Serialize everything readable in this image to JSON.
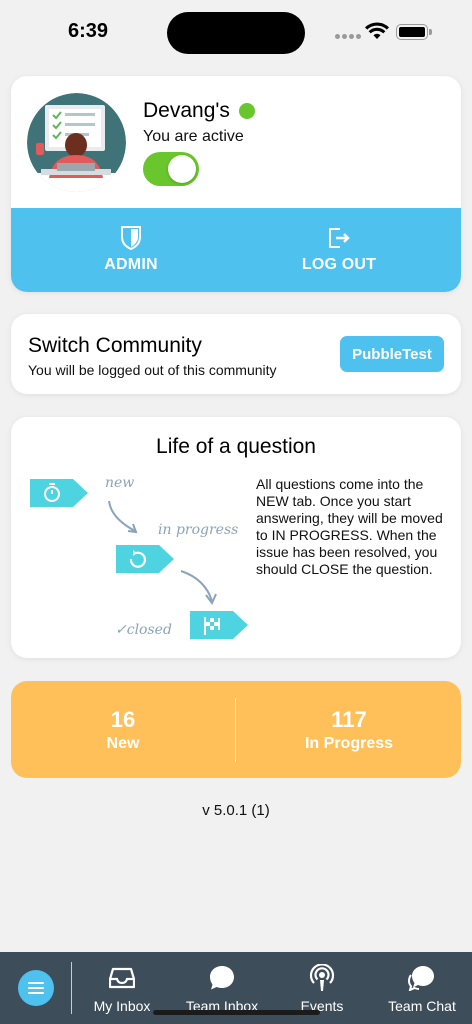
{
  "status_bar": {
    "time": "6:39"
  },
  "profile": {
    "name": "Devang's",
    "status_text": "You are active",
    "active": true,
    "online_color": "#6ac62d",
    "actions": [
      {
        "label": "ADMIN",
        "icon": "shield-icon"
      },
      {
        "label": "LOG OUT",
        "icon": "logout-icon"
      }
    ]
  },
  "community": {
    "title": "Switch Community",
    "subtitle": "You will be logged out of this community",
    "button_label": "PubbleTest"
  },
  "lifecycle": {
    "title": "Life of a question",
    "description": "All questions come into the NEW tab. Once you start answering, they will be moved to IN PROGRESS. When the issue has been resolved, you should CLOSE the question.",
    "stages": [
      {
        "label": "new",
        "icon": "stopwatch-icon"
      },
      {
        "label": "in progress",
        "icon": "refresh-icon"
      },
      {
        "label": "✓closed",
        "icon": "checkered-flag-icon"
      }
    ]
  },
  "counts": [
    {
      "value": "16",
      "label": "New"
    },
    {
      "value": "117",
      "label": "In Progress"
    }
  ],
  "version": "v 5.0.1 (1)",
  "tabbar": {
    "tabs": [
      {
        "label": "My Inbox",
        "icon": "inbox-icon"
      },
      {
        "label": "Team Inbox",
        "icon": "chat-bubble-icon"
      },
      {
        "label": "Events",
        "icon": "broadcast-icon"
      },
      {
        "label": "Team Chat",
        "icon": "team-chat-icon"
      }
    ]
  },
  "colors": {
    "accent": "#4fc1ef",
    "counts_bg": "#ffc05a",
    "tabbar_bg": "#3e4d5a",
    "active_green": "#6ac62d"
  }
}
